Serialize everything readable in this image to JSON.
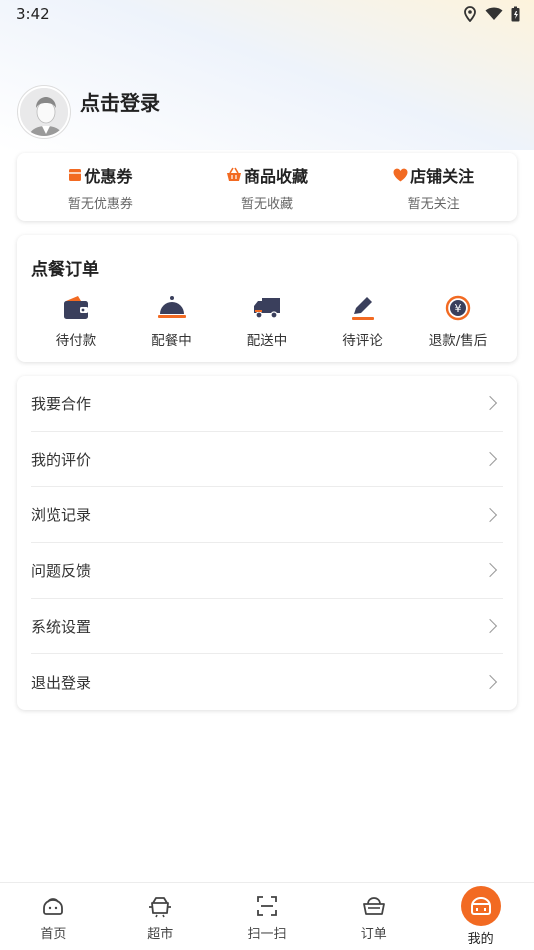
{
  "status": {
    "time": "3:42"
  },
  "profile": {
    "login_text": "点击登录"
  },
  "favorites": [
    {
      "title": "优惠券",
      "sub": "暂无优惠券",
      "icon": "coupon-icon"
    },
    {
      "title": "商品收藏",
      "sub": "暂无收藏",
      "icon": "basket-icon"
    },
    {
      "title": "店铺关注",
      "sub": "暂无关注",
      "icon": "heart-icon"
    }
  ],
  "orders": {
    "title": "点餐订单",
    "items": [
      {
        "label": "待付款",
        "icon": "wallet-icon"
      },
      {
        "label": "配餐中",
        "icon": "cloche-icon"
      },
      {
        "label": "配送中",
        "icon": "truck-icon"
      },
      {
        "label": "待评论",
        "icon": "pencil-icon"
      },
      {
        "label": "退款/售后",
        "icon": "refund-icon"
      }
    ]
  },
  "menu": [
    {
      "label": "我要合作"
    },
    {
      "label": "我的评价"
    },
    {
      "label": "浏览记录"
    },
    {
      "label": "问题反馈"
    },
    {
      "label": "系统设置"
    },
    {
      "label": "退出登录"
    }
  ],
  "tabs": [
    {
      "label": "首页",
      "icon": "home-icon"
    },
    {
      "label": "超市",
      "icon": "supermarket-icon"
    },
    {
      "label": "扫一扫",
      "icon": "scan-icon"
    },
    {
      "label": "订单",
      "icon": "order-basket-icon"
    },
    {
      "label": "我的",
      "icon": "profile-icon"
    }
  ],
  "colors": {
    "accent": "#f26a22",
    "dark_icon": "#3a3f5c"
  }
}
